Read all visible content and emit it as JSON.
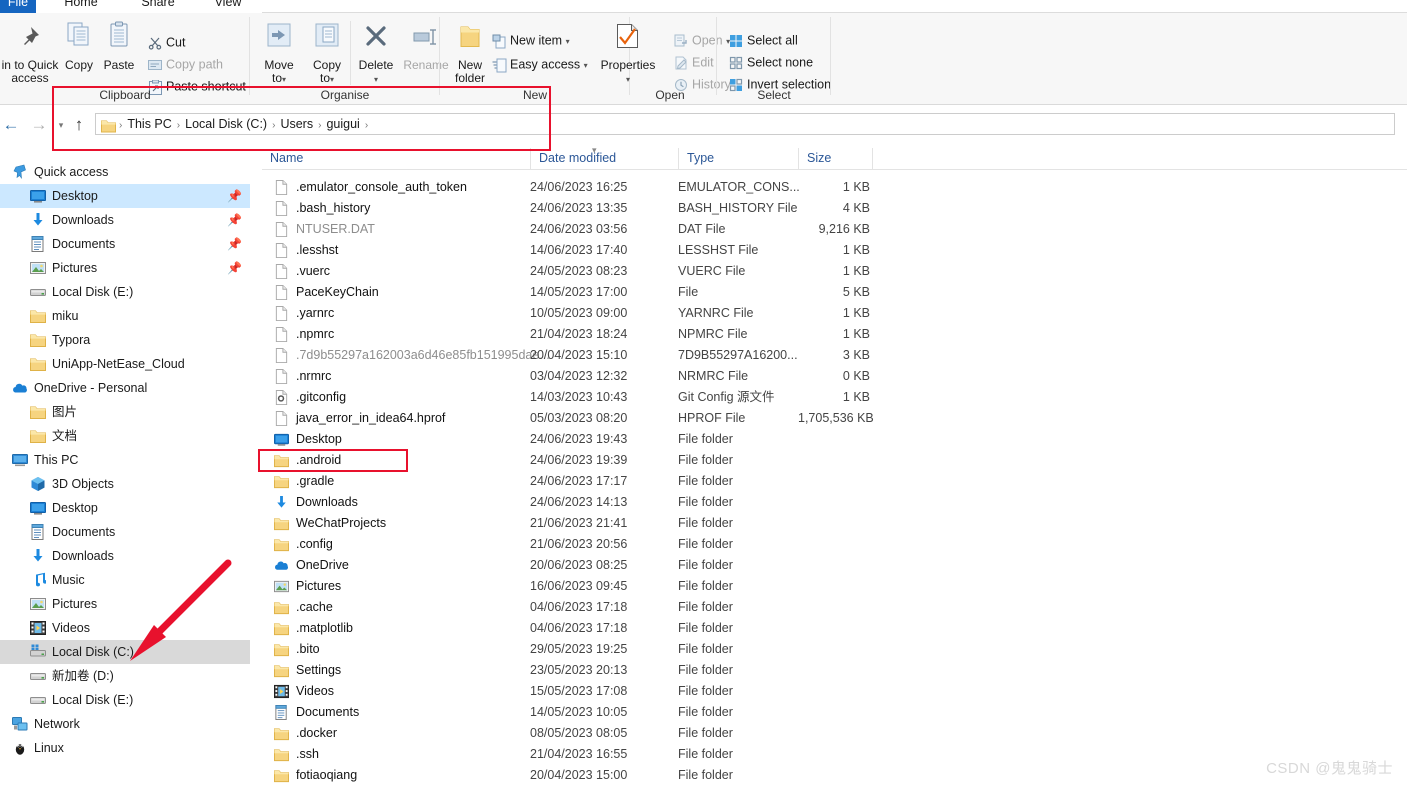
{
  "window": {
    "tabs": [
      {
        "id": "file",
        "label": "File"
      },
      {
        "id": "home",
        "label": "Home"
      },
      {
        "id": "share",
        "label": "Share"
      },
      {
        "id": "view",
        "label": "View"
      }
    ]
  },
  "ribbon": {
    "groups": [
      {
        "id": "clipboard",
        "label": "Clipboard"
      },
      {
        "id": "organise",
        "label": "Organise"
      },
      {
        "id": "new",
        "label": "New"
      },
      {
        "id": "open",
        "label": "Open"
      },
      {
        "id": "select",
        "label": "Select"
      }
    ],
    "clipboard": {
      "pin_line1": "in to Quick",
      "pin_line2": "access",
      "copy": "Copy",
      "paste": "Paste",
      "cut": "Cut",
      "copy_path": "Copy path",
      "paste_shortcut": "Paste shortcut"
    },
    "organise": {
      "move_to_l1": "Move",
      "move_to_l2": "to",
      "copy_to_l1": "Copy",
      "copy_to_l2": "to",
      "delete": "Delete",
      "rename": "Rename"
    },
    "new_group": {
      "new_folder_l1": "New",
      "new_folder_l2": "folder",
      "new_item": "New item",
      "easy_access": "Easy access"
    },
    "open_group": {
      "properties": "Properties",
      "open": "Open",
      "edit": "Edit",
      "history": "History"
    },
    "select_group": {
      "select_all": "Select all",
      "select_none": "Select none",
      "invert_selection": "Invert selection"
    }
  },
  "address": {
    "crumbs": [
      "This PC",
      "Local Disk (C:)",
      "Users",
      "guigui"
    ],
    "separator": "›"
  },
  "sidebar": {
    "items": [
      {
        "label": "Quick access",
        "icon": "quick-access-icon",
        "level": 0,
        "state": "normal",
        "pinned": false
      },
      {
        "label": "Desktop",
        "icon": "desktop-icon",
        "level": 1,
        "state": "selected",
        "pinned": true
      },
      {
        "label": "Downloads",
        "icon": "downloads-icon",
        "level": 1,
        "state": "normal",
        "pinned": true
      },
      {
        "label": "Documents",
        "icon": "documents-icon",
        "level": 1,
        "state": "normal",
        "pinned": true
      },
      {
        "label": "Pictures",
        "icon": "pictures-icon",
        "level": 1,
        "state": "normal",
        "pinned": true
      },
      {
        "label": "Local Disk (E:)",
        "icon": "drive-icon",
        "level": 1,
        "state": "normal",
        "pinned": false
      },
      {
        "label": "miku",
        "icon": "folder-icon",
        "level": 1,
        "state": "normal",
        "pinned": false
      },
      {
        "label": "Typora",
        "icon": "folder-icon",
        "level": 1,
        "state": "normal",
        "pinned": false
      },
      {
        "label": "UniApp-NetEase_Cloud",
        "icon": "folder-icon",
        "level": 1,
        "state": "normal",
        "pinned": false
      },
      {
        "label": "OneDrive - Personal",
        "icon": "onedrive-icon",
        "level": 0,
        "state": "normal",
        "pinned": false
      },
      {
        "label": "图片",
        "icon": "folder-icon",
        "level": 1,
        "state": "normal",
        "pinned": false
      },
      {
        "label": "文档",
        "icon": "folder-icon",
        "level": 1,
        "state": "normal",
        "pinned": false
      },
      {
        "label": "This PC",
        "icon": "this-pc-icon",
        "level": 0,
        "state": "normal",
        "pinned": false
      },
      {
        "label": "3D Objects",
        "icon": "3d-objects-icon",
        "level": 1,
        "state": "normal",
        "pinned": false
      },
      {
        "label": "Desktop",
        "icon": "desktop-icon",
        "level": 1,
        "state": "normal",
        "pinned": false
      },
      {
        "label": "Documents",
        "icon": "documents-icon",
        "level": 1,
        "state": "normal",
        "pinned": false
      },
      {
        "label": "Downloads",
        "icon": "downloads-icon",
        "level": 1,
        "state": "normal",
        "pinned": false
      },
      {
        "label": "Music",
        "icon": "music-icon",
        "level": 1,
        "state": "normal",
        "pinned": false
      },
      {
        "label": "Pictures",
        "icon": "pictures-icon",
        "level": 1,
        "state": "normal",
        "pinned": false
      },
      {
        "label": "Videos",
        "icon": "videos-icon",
        "level": 1,
        "state": "normal",
        "pinned": false
      },
      {
        "label": "Local Disk (C:)",
        "icon": "system-drive-icon",
        "level": 1,
        "state": "greyselected",
        "pinned": false
      },
      {
        "label": "新加卷 (D:)",
        "icon": "drive-icon",
        "level": 1,
        "state": "normal",
        "pinned": false
      },
      {
        "label": "Local Disk (E:)",
        "icon": "drive-icon",
        "level": 1,
        "state": "normal",
        "pinned": false
      },
      {
        "label": "Network",
        "icon": "network-icon",
        "level": 0,
        "state": "normal",
        "pinned": false
      },
      {
        "label": "Linux",
        "icon": "linux-icon",
        "level": 0,
        "state": "normal",
        "pinned": false
      }
    ]
  },
  "filelist": {
    "columns": [
      {
        "key": "name",
        "label": "Name",
        "sorted": true
      },
      {
        "key": "date",
        "label": "Date modified",
        "sorted": false
      },
      {
        "key": "type",
        "label": "Type",
        "sorted": false
      },
      {
        "key": "size",
        "label": "Size",
        "sorted": false
      }
    ],
    "rows": [
      {
        "name": ".emulator_console_auth_token",
        "date": "24/06/2023 16:25",
        "type": "EMULATOR_CONS...",
        "size": "1 KB",
        "icon": "file-icon",
        "dim": false
      },
      {
        "name": ".bash_history",
        "date": "24/06/2023 13:35",
        "type": "BASH_HISTORY File",
        "size": "4 KB",
        "icon": "file-icon",
        "dim": false
      },
      {
        "name": "NTUSER.DAT",
        "date": "24/06/2023 03:56",
        "type": "DAT File",
        "size": "9,216 KB",
        "icon": "file-icon",
        "dim": true
      },
      {
        "name": ".lesshst",
        "date": "14/06/2023 17:40",
        "type": "LESSHST File",
        "size": "1 KB",
        "icon": "file-icon",
        "dim": false
      },
      {
        "name": ".vuerc",
        "date": "24/05/2023 08:23",
        "type": "VUERC File",
        "size": "1 KB",
        "icon": "file-icon",
        "dim": false
      },
      {
        "name": "PaceKeyChain",
        "date": "14/05/2023 17:00",
        "type": "File",
        "size": "5 KB",
        "icon": "file-icon",
        "dim": false
      },
      {
        "name": ".yarnrc",
        "date": "10/05/2023 09:00",
        "type": "YARNRC File",
        "size": "1 KB",
        "icon": "file-icon",
        "dim": false
      },
      {
        "name": ".npmrc",
        "date": "21/04/2023 18:24",
        "type": "NPMRC File",
        "size": "1 KB",
        "icon": "file-icon",
        "dim": false
      },
      {
        "name": ".7d9b55297a162003a6d46e85fb151995dae...",
        "date": "20/04/2023 15:10",
        "type": "7D9B55297A16200...",
        "size": "3 KB",
        "icon": "file-icon",
        "dim": true
      },
      {
        "name": ".nrmrc",
        "date": "03/04/2023 12:32",
        "type": "NRMRC File",
        "size": "0 KB",
        "icon": "file-icon",
        "dim": false
      },
      {
        "name": ".gitconfig",
        "date": "14/03/2023 10:43",
        "type": "Git Config 源文件",
        "size": "1 KB",
        "icon": "gitconfig-icon",
        "dim": false
      },
      {
        "name": "java_error_in_idea64.hprof",
        "date": "05/03/2023 08:20",
        "type": "HPROF File",
        "size": "1,705,536 KB",
        "icon": "file-icon",
        "dim": false
      },
      {
        "name": "Desktop",
        "date": "24/06/2023 19:43",
        "type": "File folder",
        "size": "",
        "icon": "desktop-icon",
        "dim": false
      },
      {
        "name": ".android",
        "date": "24/06/2023 19:39",
        "type": "File folder",
        "size": "",
        "icon": "folder-icon",
        "dim": false
      },
      {
        "name": ".gradle",
        "date": "24/06/2023 17:17",
        "type": "File folder",
        "size": "",
        "icon": "folder-icon",
        "dim": false
      },
      {
        "name": "Downloads",
        "date": "24/06/2023 14:13",
        "type": "File folder",
        "size": "",
        "icon": "downloads-icon",
        "dim": false
      },
      {
        "name": "WeChatProjects",
        "date": "21/06/2023 21:41",
        "type": "File folder",
        "size": "",
        "icon": "folder-icon",
        "dim": false
      },
      {
        "name": ".config",
        "date": "21/06/2023 20:56",
        "type": "File folder",
        "size": "",
        "icon": "folder-icon",
        "dim": false
      },
      {
        "name": "OneDrive",
        "date": "20/06/2023 08:25",
        "type": "File folder",
        "size": "",
        "icon": "onedrive-icon",
        "dim": false
      },
      {
        "name": "Pictures",
        "date": "16/06/2023 09:45",
        "type": "File folder",
        "size": "",
        "icon": "pictures-icon",
        "dim": false
      },
      {
        "name": ".cache",
        "date": "04/06/2023 17:18",
        "type": "File folder",
        "size": "",
        "icon": "folder-icon",
        "dim": false
      },
      {
        "name": ".matplotlib",
        "date": "04/06/2023 17:18",
        "type": "File folder",
        "size": "",
        "icon": "folder-icon",
        "dim": false
      },
      {
        "name": ".bito",
        "date": "29/05/2023 19:25",
        "type": "File folder",
        "size": "",
        "icon": "folder-icon",
        "dim": false
      },
      {
        "name": "Settings",
        "date": "23/05/2023 20:13",
        "type": "File folder",
        "size": "",
        "icon": "folder-icon",
        "dim": false
      },
      {
        "name": "Videos",
        "date": "15/05/2023 17:08",
        "type": "File folder",
        "size": "",
        "icon": "videos-icon",
        "dim": false
      },
      {
        "name": "Documents",
        "date": "14/05/2023 10:05",
        "type": "File folder",
        "size": "",
        "icon": "documents-icon",
        "dim": false
      },
      {
        "name": ".docker",
        "date": "08/05/2023 08:05",
        "type": "File folder",
        "size": "",
        "icon": "folder-icon",
        "dim": false
      },
      {
        "name": ".ssh",
        "date": "21/04/2023 16:55",
        "type": "File folder",
        "size": "",
        "icon": "folder-icon",
        "dim": false
      },
      {
        "name": "fotiaoqiang",
        "date": "20/04/2023 15:00",
        "type": "File folder",
        "size": "",
        "icon": "folder-icon",
        "dim": false
      }
    ]
  },
  "annotations": {
    "highlight_color": "#e8112d",
    "arrow_color": "#e8112d",
    "watermark": "CSDN @鬼鬼骑士"
  }
}
